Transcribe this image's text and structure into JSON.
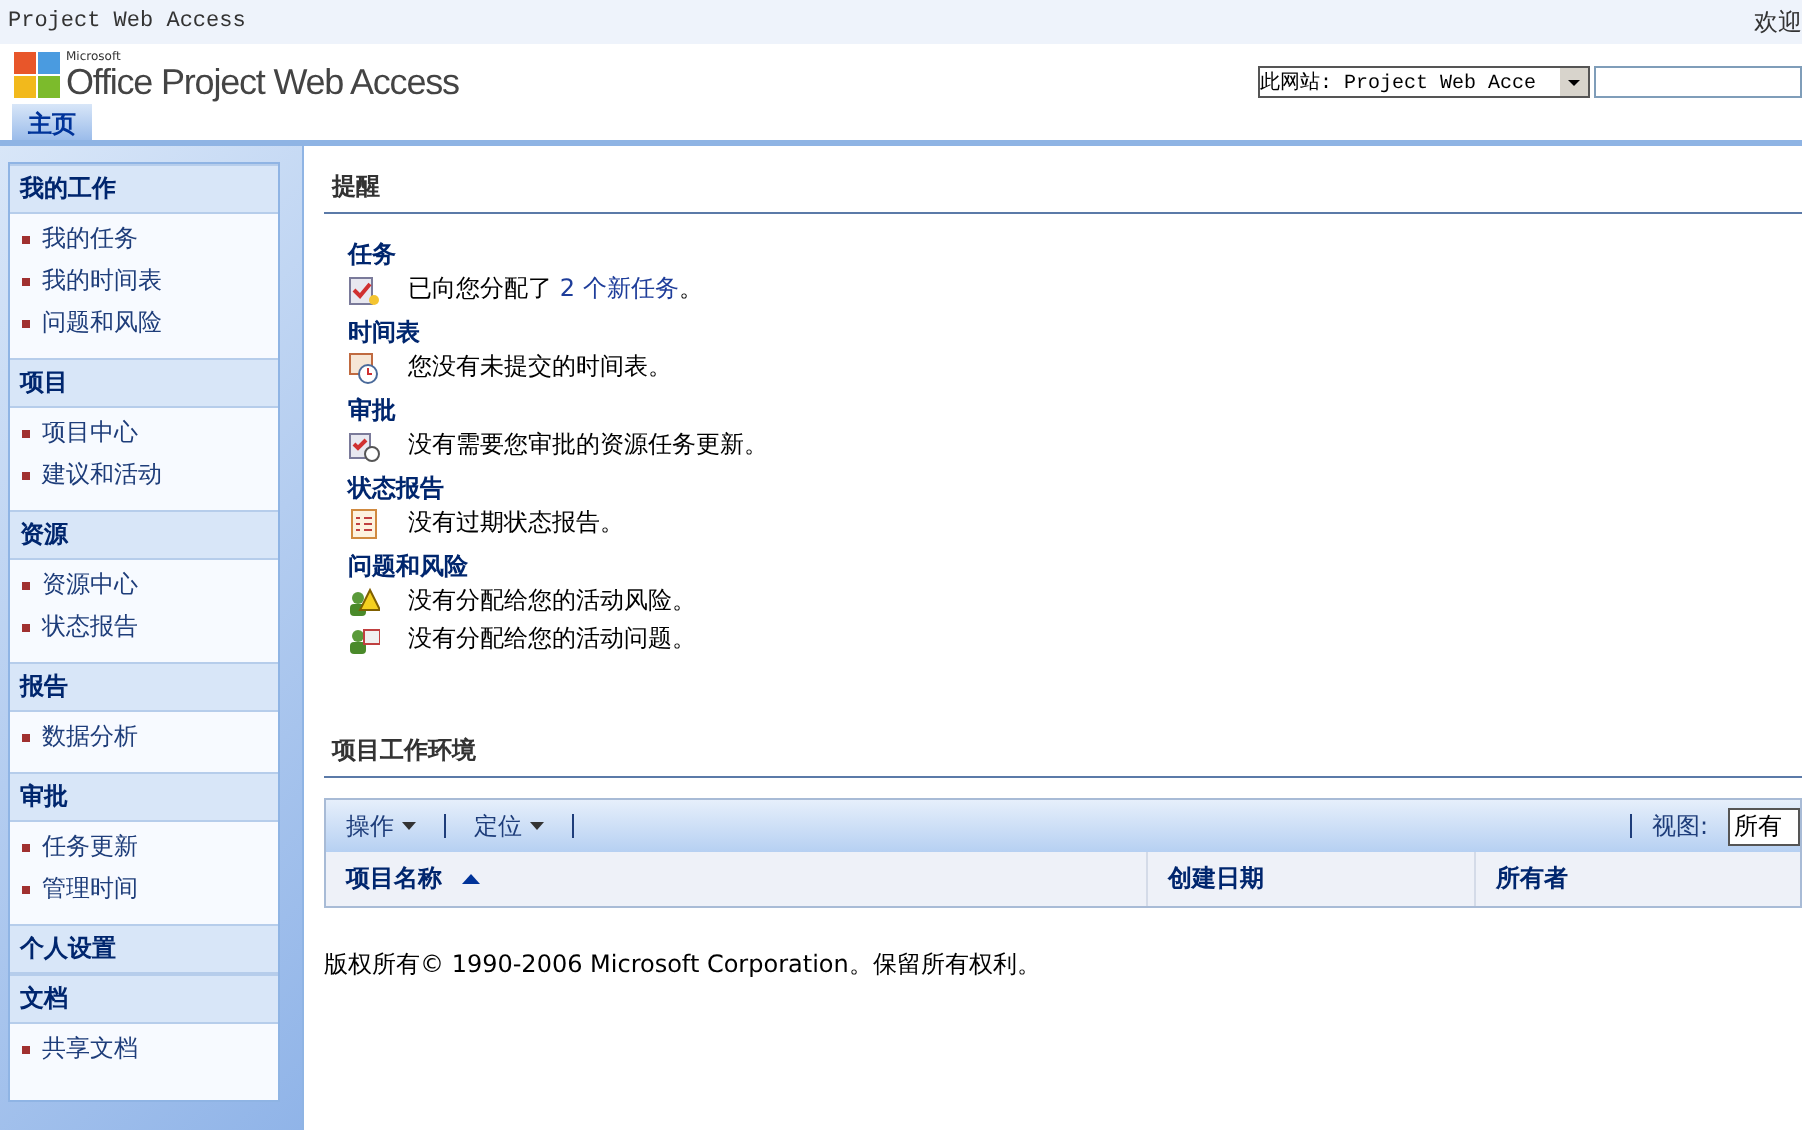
{
  "top_bar": {
    "site_name": "Project Web Access",
    "welcome": "欢迎"
  },
  "header": {
    "logo_small": "Microsoft",
    "logo_text": "Office Project Web Access",
    "scope_select": "此网站: Project Web Acce"
  },
  "tabs": [
    {
      "label": "主页",
      "selected": true
    }
  ],
  "sidebar": {
    "groups": [
      {
        "title": "我的工作",
        "items": [
          "我的任务",
          "我的时间表",
          "问题和风险"
        ]
      },
      {
        "title": "项目",
        "items": [
          "项目中心",
          "建议和活动"
        ]
      },
      {
        "title": "资源",
        "items": [
          "资源中心",
          "状态报告"
        ]
      },
      {
        "title": "报告",
        "items": [
          "数据分析"
        ]
      },
      {
        "title": "审批",
        "items": [
          "任务更新",
          "管理时间"
        ]
      },
      {
        "title": "个人设置"
      },
      {
        "title": "文档",
        "items": [
          "共享文档"
        ]
      }
    ]
  },
  "reminders": {
    "title": "提醒",
    "sections": [
      {
        "title": "任务",
        "rows": [
          {
            "kind": "task",
            "text": "已向您分配了 ",
            "link": "2 个新任务",
            "after": "。"
          }
        ]
      },
      {
        "title": "时间表",
        "rows": [
          {
            "kind": "timesheet",
            "text": "您没有未提交的时间表。"
          }
        ]
      },
      {
        "title": "审批",
        "rows": [
          {
            "kind": "approval",
            "text": "没有需要您审批的资源任务更新。"
          }
        ]
      },
      {
        "title": "状态报告",
        "rows": [
          {
            "kind": "report",
            "text": "没有过期状态报告。"
          }
        ]
      },
      {
        "title": "问题和风险",
        "rows": [
          {
            "kind": "risk",
            "text": "没有分配给您的活动风险。"
          },
          {
            "kind": "issue",
            "text": "没有分配给您的活动问题。"
          }
        ]
      }
    ]
  },
  "workspace": {
    "title": "项目工作环境",
    "toolbar": [
      "操作",
      "定位"
    ],
    "view_label": "视图:",
    "view_value": "所有",
    "columns": [
      "项目名称",
      "创建日期",
      "所有者"
    ]
  },
  "footer": "版权所有© 1990-2006 Microsoft Corporation。保留所有权利。"
}
